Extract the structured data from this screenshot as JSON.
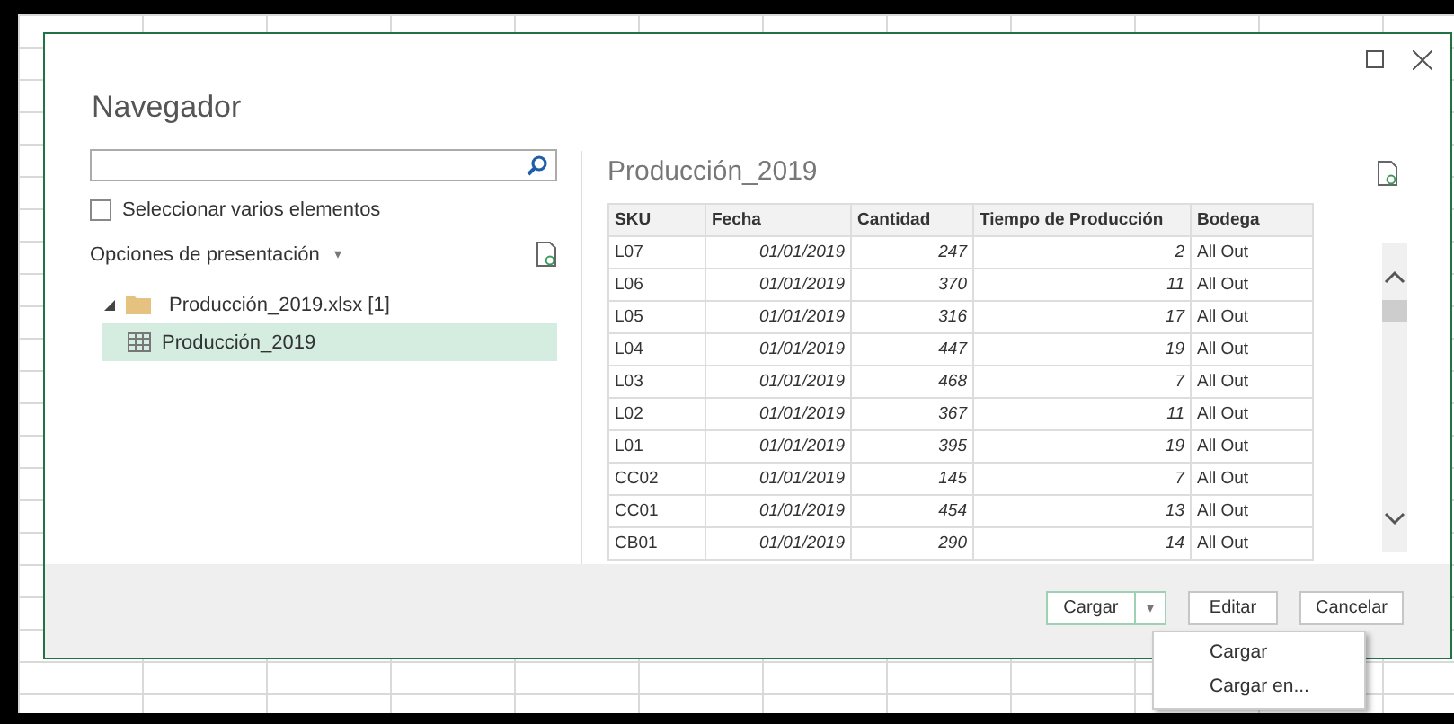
{
  "dialog": {
    "title": "Navegador"
  },
  "select_multiple": {
    "label": "Seleccionar varios elementos",
    "checked": false
  },
  "display_options": {
    "label": "Opciones de presentación",
    "caret": "▾"
  },
  "tree": [
    {
      "label": "Producción_2019.xlsx [1]",
      "expanded": true,
      "children": [
        {
          "label": "Producción_2019",
          "selected": true
        }
      ]
    }
  ],
  "preview": {
    "title": "Producción_2019",
    "columns": [
      "SKU",
      "Fecha",
      "Cantidad",
      "Tiempo de Producción",
      "Bodega"
    ],
    "rows": [
      [
        "L07",
        "01/01/2019",
        "247",
        "2",
        "All Out"
      ],
      [
        "L06",
        "01/01/2019",
        "370",
        "11",
        "All Out"
      ],
      [
        "L05",
        "01/01/2019",
        "316",
        "17",
        "All Out"
      ],
      [
        "L04",
        "01/01/2019",
        "447",
        "19",
        "All Out"
      ],
      [
        "L03",
        "01/01/2019",
        "468",
        "7",
        "All Out"
      ],
      [
        "L02",
        "01/01/2019",
        "367",
        "11",
        "All Out"
      ],
      [
        "L01",
        "01/01/2019",
        "395",
        "19",
        "All Out"
      ],
      [
        "CC02",
        "01/01/2019",
        "145",
        "7",
        "All Out"
      ],
      [
        "CC01",
        "01/01/2019",
        "454",
        "13",
        "All Out"
      ],
      [
        "CB01",
        "01/01/2019",
        "290",
        "14",
        "All Out"
      ]
    ]
  },
  "buttons": [
    {
      "label": "Cargar",
      "kind": "split",
      "caret": "▾"
    },
    {
      "label": "Editar",
      "kind": "plain"
    },
    {
      "label": "Cancelar",
      "kind": "plain"
    }
  ],
  "menu": {
    "open": true,
    "items": [
      "Cargar",
      "Cargar en..."
    ]
  }
}
